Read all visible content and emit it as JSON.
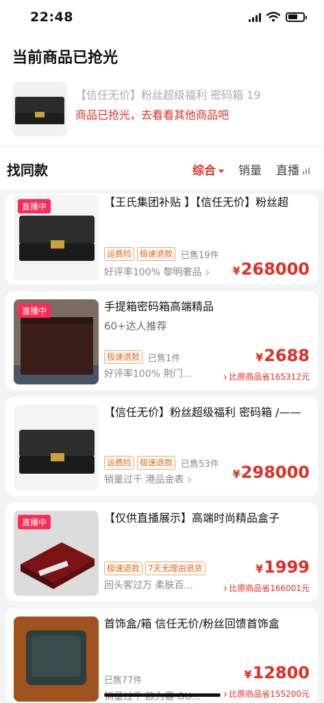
{
  "status": {
    "time": "22:48"
  },
  "header": {
    "title": "当前商品已抢光",
    "sold_item_name": "【信任无价】粉丝超级福利 密码箱 19",
    "sold_hint": "商品已抢光，去看看其他商品吧"
  },
  "find": {
    "title": "找同款",
    "tabs": [
      {
        "label": "综合",
        "active": true
      },
      {
        "label": "销量",
        "active": false
      },
      {
        "label": "直播",
        "active": false
      }
    ]
  },
  "products": [
    {
      "live": "直播中",
      "title": "【王氏集团补贴 】【信任无价】粉丝超",
      "subtitle": "",
      "tags": [
        "运费险",
        "极速退款"
      ],
      "sold": "已售19件",
      "meta": "好评率100% 黎明奢品",
      "price": "268000",
      "save": ""
    },
    {
      "live": "直播中",
      "title": "手提箱密码箱高端精品",
      "subtitle": "60+达人推荐",
      "tags": [
        "极速退款"
      ],
      "sold": "已售1件",
      "meta": "好评率100% 荆门...",
      "price": "2688",
      "save": "比原商品省165312元"
    },
    {
      "live": "",
      "title": "【信任无价】粉丝超级福利 密码箱 /——",
      "subtitle": "",
      "tags": [
        "运费险",
        "极速退款"
      ],
      "sold": "已售53件",
      "meta": "销量过千 港品金表",
      "price": "298000",
      "save": ""
    },
    {
      "live": "直播中",
      "title": "【仅供直播展示】高端时尚精品盒子",
      "subtitle": "",
      "tags": [
        "极速退款",
        "7天无理由退货"
      ],
      "sold": "",
      "meta": "回头客过万 柔肤百...",
      "price": "1999",
      "save": "比原商品省166001元"
    },
    {
      "live": "",
      "title": "首饰盒/箱 信任无价/粉丝回馈首饰盒",
      "subtitle": "",
      "tags": [],
      "sold": "已售77件",
      "meta": "销量过千 欧为嘉 OU...",
      "price": "12800",
      "save": "比原商品省155200元"
    }
  ],
  "icons": {
    "signal": "signal-icon",
    "wifi": "wifi-icon",
    "battery": "battery-icon",
    "sort_caret": "caret-down-icon",
    "live_bars": "live-bars-icon",
    "chevron": "chevron-right-icon"
  },
  "colors": {
    "accent": "#e02e24",
    "live_badge": "#ff2a55",
    "tag": "#e8620c"
  }
}
